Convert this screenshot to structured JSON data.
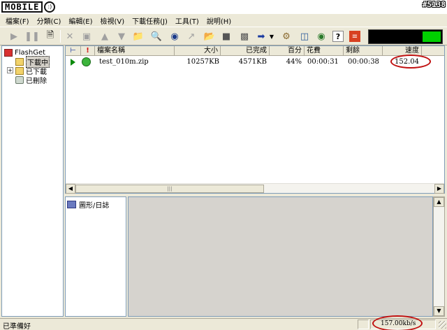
{
  "window": {
    "logo_text": "MOBILE",
    "logo_face": ":)",
    "watermark_tag": "#5138"
  },
  "menu": [
    "檔案(F)",
    "分類(C)",
    "編輯(E)",
    "檢視(V)",
    "下載任務(J)",
    "工具(T)",
    "說明(H)"
  ],
  "toolbar": {
    "buttons": [
      "start-icon",
      "pause-icon",
      "new-icon",
      "delete-icon",
      "properties-icon",
      "move-up-icon",
      "move-down-icon",
      "open-folder-icon",
      "find-icon",
      "find-next-icon",
      "site-explorer-icon",
      "open-file-icon",
      "schedule-icon",
      "import-icon",
      "export-icon",
      "options-icon",
      "connection-icon",
      "help-icon",
      "exit-icon"
    ],
    "speed_meter_level": 0.25,
    "colors": {
      "meter_bg": "#000000",
      "meter_bar": "#00d000"
    }
  },
  "tree": {
    "root": "FlashGet",
    "items": [
      {
        "label": "下載中",
        "selected": true
      },
      {
        "label": "已下載",
        "selected": false
      },
      {
        "label": "已刪除",
        "selected": false
      }
    ]
  },
  "downloads": {
    "columns": [
      "檔案名稱",
      "大小",
      "已完成",
      "百分",
      "花費",
      "剩餘",
      "速度"
    ],
    "rows": [
      {
        "status": "downloading",
        "name": "test_010m.zip",
        "size": "10257KB",
        "completed": "4571KB",
        "percent": "44%",
        "elapsed": "00:00:31",
        "remaining": "00:00:38",
        "speed": "152.04"
      }
    ],
    "highlight_color": "#c01010"
  },
  "bottom": {
    "graph_log_label": "圖形/日誌"
  },
  "statusbar": {
    "status_text": "已準備好",
    "rate": "157.00kb/s"
  }
}
